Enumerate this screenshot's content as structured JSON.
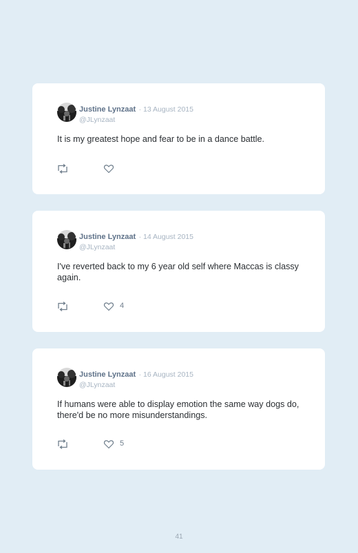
{
  "tweets": [
    {
      "name": "Justine Lynzaat",
      "date": "· 13 August 2015",
      "handle": "@JLynzaat",
      "text": "It is my greatest hope and fear to be in a dance battle.",
      "likes": ""
    },
    {
      "name": "Justine Lynzaat",
      "date": "· 14 August 2015",
      "handle": "@JLynzaat",
      "text": "I've reverted back to my 6 year old self where Maccas is classy again.",
      "likes": "4"
    },
    {
      "name": "Justine Lynzaat",
      "date": "· 16 August 2015",
      "handle": "@JLynzaat",
      "text": "If humans were able to display emotion the same way dogs do, there'd be no more misunderstandings.",
      "likes": "5"
    }
  ],
  "page_number": "41",
  "icons": {
    "retweet": "retweet-icon",
    "like": "heart-icon"
  },
  "colors": {
    "background": "#e1edf5",
    "card": "#ffffff",
    "name": "#5f7289",
    "meta": "#a7b4c2",
    "text": "#2b2f33"
  }
}
